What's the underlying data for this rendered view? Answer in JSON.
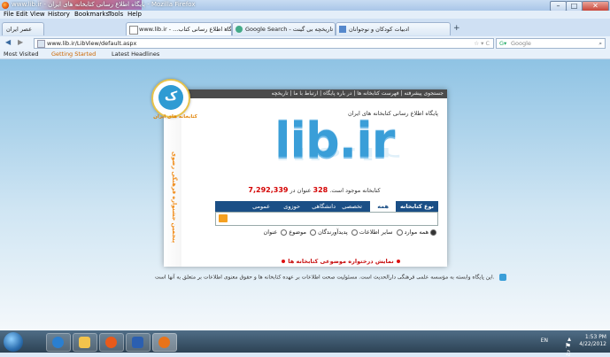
{
  "window": {
    "title": "www.lib.ir - پایگاه اطلاع رسانی کتابخانه های ایران - Mozilla Firefox"
  },
  "menu": [
    "File",
    "Edit",
    "View",
    "History",
    "Bookmarks",
    "Tools",
    "Help"
  ],
  "tabs": [
    {
      "label": "عصر ایران",
      "active": false
    },
    {
      "label": "www.lib.ir - ...پایگاه اطلاع رسانی کتاب",
      "active": true
    },
    {
      "label": "Google Search - تاریخچه بی گینت",
      "active": false
    },
    {
      "label": "ادبیات کودکان و نوجوانان",
      "active": false
    }
  ],
  "nav": {
    "url": "www.lib.ir/LibView/default.aspx",
    "search_placeholder": "Google"
  },
  "bookmarks": [
    "Most Visited",
    "Getting Started",
    "Latest Headlines"
  ],
  "site": {
    "header_links": "جستجوی پیشرفته | فهرست کتابخانه ها | در باره پایگاه | ارتباط با ما | تاریخچه",
    "logo_glyph": "ک",
    "logo_caption": "کتابخانه های ایران",
    "side_vertical_text": "پنجمین جشنواره فرهنگی رضوی",
    "tagline": "پایگاه اطلاع رسانی کتابخانه های ایران",
    "brand": "lib.ir",
    "count_prefix": "کتابخانه موجود است.",
    "count_value": "7,292,339",
    "count_mid": "عنوان در",
    "library_count": "328",
    "search_tabs": [
      "نوع کتابخانه",
      "همه",
      "تخصصی",
      "دانشگاهی",
      "حوزوی",
      "عمومی"
    ],
    "radios": [
      "عنوان",
      "موضوع",
      "پدیدآورندگان",
      "سایر اطلاعات",
      "همه موارد"
    ],
    "thematic_link": "نمایش درختواره موضوعی کتابخانه ها",
    "footer": "این پایگاه وابسته به مؤسسه علمی فرهنگی دارالحدیث است. مسئولیت صحت اطلاعات بر عهده کتابخانه ها و حقوق معنوی اطلاعات بر متعلق به آنها است."
  },
  "tray": {
    "time": "1:53 PM",
    "date": "4/22/2012",
    "lang": "EN"
  },
  "colors": {
    "accent": "#3a9ed8",
    "tab_bar": "#1b4f86",
    "count": "#d40000",
    "link": "#c81010"
  }
}
